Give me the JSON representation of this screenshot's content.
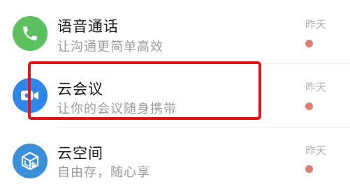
{
  "colors": {
    "voice_call_icon_bg": "#5cc05f",
    "cloud_meeting_icon_bg": "#2e86ea",
    "cloud_space_icon_bg": "#3b8ed8",
    "unread_dot": "#e07d72",
    "highlight_border": "#e3121d"
  },
  "items": [
    {
      "icon": "phone-icon",
      "title": "语音通话",
      "subtitle": "让沟通更简单高效",
      "time": "昨天",
      "unread": true
    },
    {
      "icon": "video-camera-icon",
      "title": "云会议",
      "subtitle": "让你的会议随身携带",
      "time": "昨天",
      "unread": true,
      "highlighted": true
    },
    {
      "icon": "cloud-space-icon",
      "title": "云空间",
      "subtitle": "自由存，随心享",
      "time": "昨天",
      "unread": true
    }
  ]
}
